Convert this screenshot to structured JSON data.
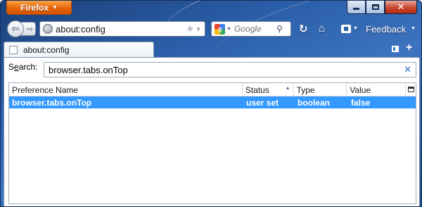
{
  "app": {
    "button_label": "Firefox"
  },
  "toolbar": {
    "url": "about:config",
    "search_placeholder": "Google",
    "feedback_label": "Feedback"
  },
  "tabs": [
    {
      "label": "about:config"
    }
  ],
  "config": {
    "search_label_prefix": "S",
    "search_label_accesskey": "e",
    "search_label_rest": "arch:",
    "search_value": "browser.tabs.onTop",
    "columns": {
      "name": "Preference Name",
      "status": "Status",
      "type": "Type",
      "value": "Value"
    },
    "sort_column": "Status",
    "rows": [
      {
        "name": "browser.tabs.onTop",
        "status": "user set",
        "type": "boolean",
        "value": "false",
        "selected": true
      }
    ]
  },
  "icons": {
    "app_menu": "chevron-down-icon",
    "back": "back-arrow-icon",
    "forward": "forward-arrow-icon",
    "site": "globe-icon",
    "bookmark": "star-icon",
    "search_engine": "google-icon",
    "search": "magnifier-icon",
    "reload": "reload-icon",
    "home": "home-icon",
    "feedback": "feedback-icon",
    "tab_list": "tab-list-icon",
    "new_tab": "plus-icon",
    "clear": "close-icon",
    "column_picker": "column-picker-icon"
  },
  "colors": {
    "app_button": "#e66000",
    "selection": "#3399ff",
    "close_button": "#c8462f",
    "chrome": "#2a5ea8"
  }
}
